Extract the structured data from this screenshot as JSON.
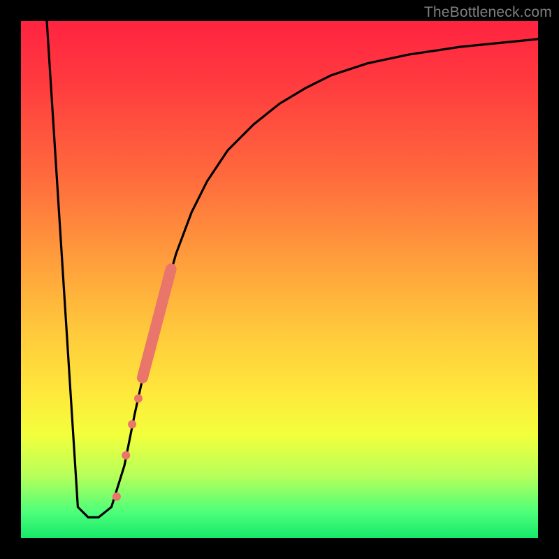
{
  "watermark": {
    "text": "TheBottleneck.com"
  },
  "chart_data": {
    "type": "line",
    "title": "",
    "xlabel": "",
    "ylabel": "",
    "xrange": [
      0,
      100
    ],
    "yrange": [
      0,
      100
    ],
    "grid": false,
    "legend": false,
    "series": [
      {
        "name": "bottleneck-curve",
        "color": "#000000",
        "x": [
          5,
          11,
          13,
          15,
          17.5,
          20,
          22,
          24,
          26,
          28,
          30,
          33,
          36,
          40,
          45,
          50,
          55,
          60,
          67,
          75,
          85,
          95,
          100
        ],
        "y": [
          100,
          6,
          4,
          4,
          6,
          14,
          24,
          33,
          41,
          48,
          55,
          63,
          69,
          75,
          80,
          84,
          87,
          89.5,
          91.8,
          93.5,
          95,
          96,
          96.5
        ]
      }
    ],
    "markers": [
      {
        "name": "dot-1",
        "x": 18.5,
        "y": 8,
        "r": 6,
        "color": "#e9756b"
      },
      {
        "name": "dot-2",
        "x": 20.3,
        "y": 16,
        "r": 6,
        "color": "#e9756b"
      },
      {
        "name": "dot-3",
        "x": 21.5,
        "y": 22,
        "r": 6,
        "color": "#e9756b"
      },
      {
        "name": "dot-4",
        "x": 22.7,
        "y": 27,
        "r": 6,
        "color": "#e9756b"
      },
      {
        "name": "pill",
        "x1": 23.5,
        "y1": 31,
        "x2": 29.0,
        "y2": 52,
        "width": 16,
        "color": "#e9756b"
      }
    ],
    "background_gradient": {
      "top": "#ff2340",
      "bottom": "#17e86a"
    }
  }
}
